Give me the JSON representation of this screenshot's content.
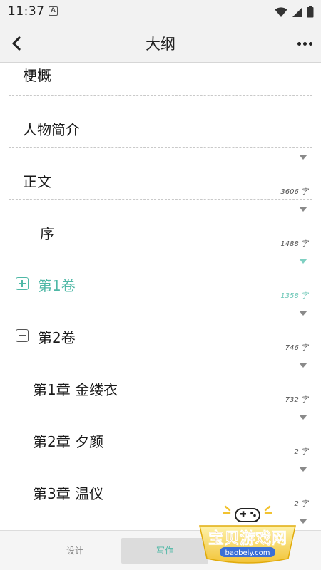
{
  "status_bar": {
    "time": "11:37",
    "notification_letter": "A"
  },
  "app_bar": {
    "title": "大纲"
  },
  "outline": {
    "items": [
      {
        "label": "梗概"
      },
      {
        "label": "人物简介"
      },
      {
        "label": "正文",
        "count": "3606 字"
      },
      {
        "label": "序",
        "count": "1488 字"
      },
      {
        "label": "第1卷",
        "count": "1358 字",
        "toggle": "expand",
        "highlighted": true
      },
      {
        "label": "第2卷",
        "count": "746 字",
        "toggle": "collapse"
      },
      {
        "label": "第1章 金缕衣",
        "count": "732 字"
      },
      {
        "label": "第2章 夕颜",
        "count": "2 字"
      },
      {
        "label": "第3章 温仪",
        "count": "2 字"
      }
    ]
  },
  "tabs": {
    "design": "设计",
    "write": "写作"
  },
  "watermark": {
    "title": "宝贝游戏网",
    "url": "baobeiy.com"
  },
  "colors": {
    "accent": "#4fb8a6",
    "bar_background": "#f2f2f2"
  }
}
